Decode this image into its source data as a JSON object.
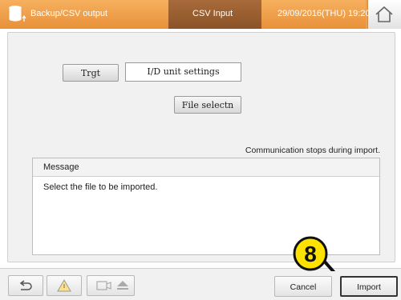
{
  "header": {
    "section": "Backup/CSV output",
    "title": "CSV Input",
    "datetime": "29/09/2016(THU) 19:20"
  },
  "target": {
    "label": "Trgt",
    "value": "I/D unit settings"
  },
  "file_select": {
    "label": "File selectn"
  },
  "note": "Communication stops during import.",
  "message": {
    "heading": "Message",
    "text": "Select the file to be imported."
  },
  "footer": {
    "cancel_label": "Cancel",
    "import_label": "Import"
  },
  "callout": {
    "number": "8"
  },
  "icons": [
    "database-icon",
    "home-icon",
    "back-icon",
    "warning-icon",
    "camera-icon",
    "eject-icon"
  ],
  "colors": {
    "header_orange": "#f0a04a",
    "header_active": "#8a5428",
    "callout_fill": "#ffe200"
  }
}
